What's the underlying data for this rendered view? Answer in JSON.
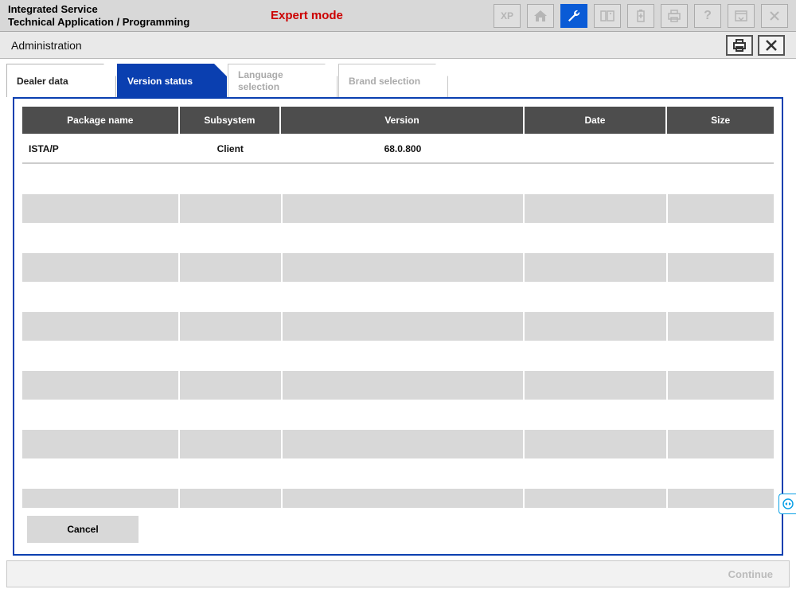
{
  "app": {
    "title_line1": "Integrated Service",
    "title_line2": "Technical Application / Programming",
    "mode_label": "Expert mode",
    "toolbar": {
      "xp": "XP"
    }
  },
  "subbar": {
    "title": "Administration"
  },
  "tabs": [
    {
      "label": "Dealer data",
      "state": "normal"
    },
    {
      "label": "Version status",
      "state": "active"
    },
    {
      "label_line1": "Language",
      "label_line2": "selection",
      "state": "disabled"
    },
    {
      "label": "Brand selection",
      "state": "disabled"
    }
  ],
  "grid": {
    "headers": {
      "package": "Package name",
      "subsystem": "Subsystem",
      "version": "Version",
      "date": "Date",
      "size": "Size"
    },
    "rows": [
      {
        "package": "ISTA/P",
        "subsystem": "Client",
        "version": "68.0.800",
        "date": "",
        "size": ""
      }
    ],
    "empty_row_count": 6
  },
  "buttons": {
    "cancel": "Cancel",
    "continue": "Continue"
  }
}
